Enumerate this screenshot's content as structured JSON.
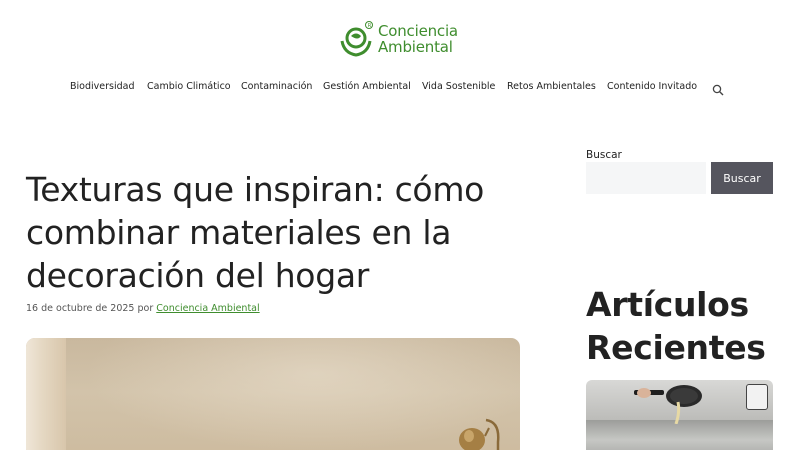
{
  "site": {
    "logo_line1": "Conciencia",
    "logo_line2": "Ambiental",
    "brand_color": "#3f8d2e"
  },
  "nav": {
    "items": [
      {
        "label": "Biodiversidad"
      },
      {
        "label": "Cambio Climático"
      },
      {
        "label": "Contaminación"
      },
      {
        "label": "Gestión Ambiental"
      },
      {
        "label": "Vida Sostenible"
      },
      {
        "label": "Retos Ambientales"
      },
      {
        "label": "Contenido Invitado"
      }
    ],
    "search_icon": "search-icon"
  },
  "article": {
    "title": "Texturas que inspiran: cómo combinar materiales en la decoración del hogar",
    "date": "16 de octubre de 2025",
    "by": "por",
    "author": "Conciencia Ambiental"
  },
  "sidebar": {
    "search_label": "Buscar",
    "search_value": "",
    "search_button": "Buscar",
    "recent_title": "Artículos Recientes"
  }
}
